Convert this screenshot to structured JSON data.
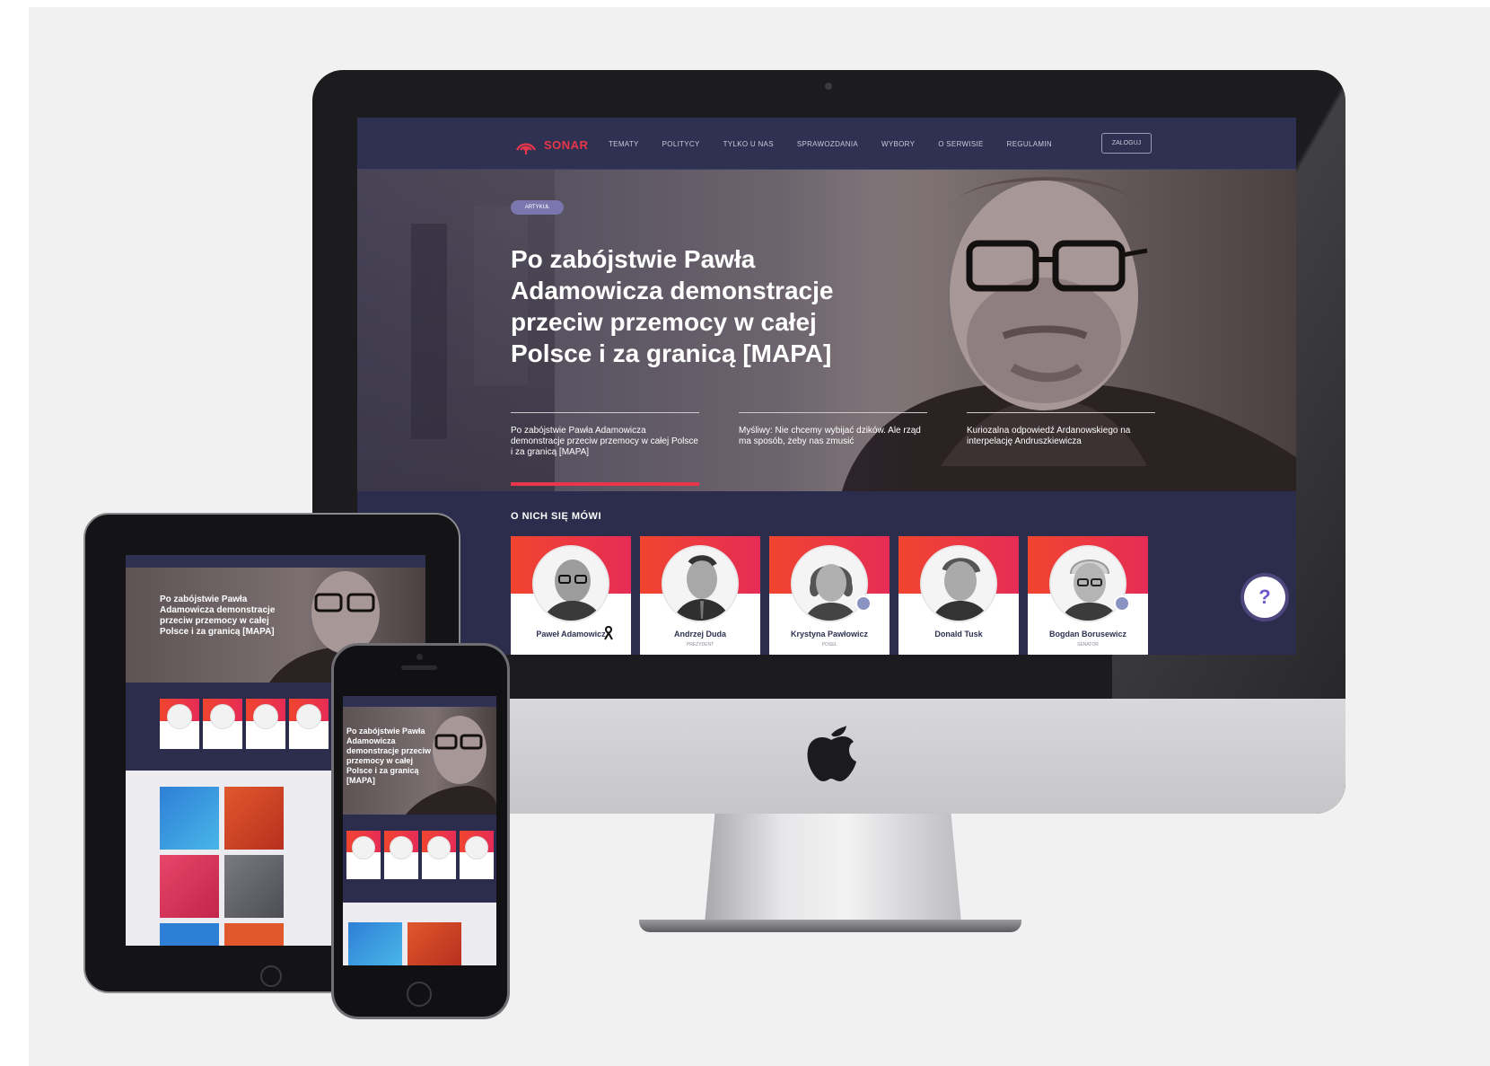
{
  "site": {
    "brand": "SONAR",
    "nav": [
      "TEMATY",
      "POLITYCY",
      "TYLKO U NAS",
      "SPRAWOZDANIA",
      "WYBORY",
      "O SERWISIE",
      "REGULAMIN"
    ],
    "login_label": "ZALOGUJ",
    "hero": {
      "badge": "ARTYKUŁ",
      "title": "Po zabójstwie Pawła Adamowicza demonstracje przeciw przemocy w całej Polsce i za granicą [MAPA]",
      "teasers": [
        "Po zabójstwie Pawła Adamowicza demonstracje przeciw przemocy w całej Polsce i za granicą [MAPA]",
        "Myśliwy: Nie chcemy wybijać dzików. Ale rząd ma sposób, żeby nas zmusić",
        "Kuriozalna odpowiedź Ardanowskiego na interpelację Andruszkiewicza"
      ]
    },
    "people_section_title": "O NICH SIĘ MÓWI",
    "people": [
      {
        "name": "Paweł Adamowicz",
        "role": ""
      },
      {
        "name": "Andrzej Duda",
        "role": "PREZYDENT"
      },
      {
        "name": "Krystyna Pawłowicz",
        "role": "POSEŁ"
      },
      {
        "name": "Donald Tusk",
        "role": ""
      },
      {
        "name": "Bogdan Borusewicz",
        "role": "SENATOR"
      }
    ],
    "help_label": "?"
  },
  "tablet": {
    "hero_title": "Po zabójstwie Pawła Adamowicza demonstracje przeciw przemocy w całej Polsce i za granicą [MAPA]"
  },
  "phone": {
    "hero_title": "Po zabójstwie Pawła Adamowicza demonstracje przeciw przemocy w całej Polsce i za granicą [MAPA]"
  },
  "colors": {
    "navy": "#2f3152",
    "accent_red": "#e9364b",
    "card_gradient_start": "#f0452f",
    "card_gradient_end": "#e62c56",
    "badge_purple": "#7b76ad"
  },
  "icons": [
    "sonar-logo-icon",
    "apple-logo-icon",
    "black-ribbon-icon",
    "party-badge-icon",
    "help-icon"
  ]
}
